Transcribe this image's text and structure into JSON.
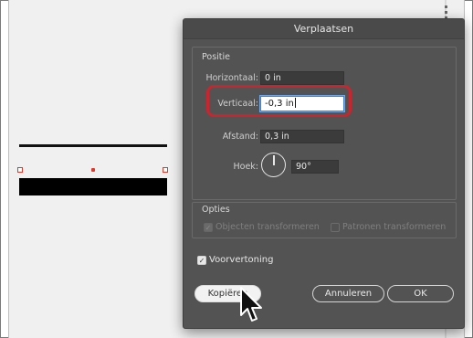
{
  "dialog": {
    "title": "Verplaatsen",
    "position": {
      "heading": "Positie",
      "horizontal_label": "Horizontaal:",
      "horizontal_value": "0 in",
      "vertical_label": "Verticaal:",
      "vertical_value": "-0,3 in",
      "distance_label": "Afstand:",
      "distance_value": "0,3 in",
      "angle_label": "Hoek:",
      "angle_value": "90°"
    },
    "options": {
      "heading": "Opties",
      "transform_objects_label": "Objecten transformeren",
      "transform_objects_checked": true,
      "transform_patterns_label": "Patronen transformeren",
      "transform_patterns_checked": false
    },
    "preview": {
      "label": "Voorvertoning",
      "checked": true
    },
    "buttons": {
      "copy": "Kopiëren",
      "cancel": "Annuleren",
      "ok": "OK"
    }
  },
  "colors": {
    "dialog_bg": "#535353",
    "highlight": "#c9252f",
    "anchor": "#e0392c",
    "focus": "#3a80d6"
  },
  "icons": {
    "angle_dial": "angle-dial-icon",
    "cursor": "arrow-cursor-icon",
    "checkmark": "checkmark-icon"
  }
}
